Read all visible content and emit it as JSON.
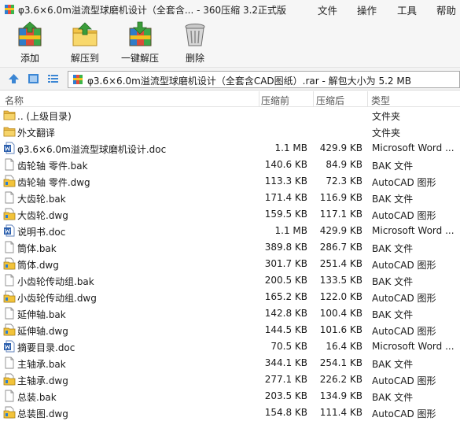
{
  "window": {
    "title": "φ3.6×6.0m溢流型球磨机设计（全套含... - 360压缩 3.2正式版",
    "app_icon": "archive-app-icon"
  },
  "menu": {
    "items": [
      "文件",
      "操作",
      "工具",
      "帮助"
    ]
  },
  "toolbar": {
    "add_label": "添加",
    "extract_label": "解压到",
    "oneclick_label": "一键解压",
    "delete_label": "删除"
  },
  "address": {
    "path_text": "φ3.6×6.0m溢流型球磨机设计（全套含CAD图纸）.rar - 解包大小为 5.2 MB"
  },
  "columns": {
    "name": "名称",
    "size": "压缩前",
    "packed": "压缩后",
    "type": "类型"
  },
  "files": [
    {
      "name": ".. (上级目录)",
      "size": "",
      "packed": "",
      "type": "文件夹",
      "icon": "folder-up-icon"
    },
    {
      "name": "外文翻译",
      "size": "",
      "packed": "",
      "type": "文件夹",
      "icon": "folder-icon"
    },
    {
      "name": "φ3.6×6.0m溢流型球磨机设计.doc",
      "size": "1.1 MB",
      "packed": "429.9 KB",
      "type": "Microsoft Word ...",
      "icon": "word-doc-icon"
    },
    {
      "name": "齿轮轴 零件.bak",
      "size": "140.6 KB",
      "packed": "84.9 KB",
      "type": "BAK 文件",
      "icon": "blank-file-icon"
    },
    {
      "name": "齿轮轴 零件.dwg",
      "size": "113.3 KB",
      "packed": "72.3 KB",
      "type": "AutoCAD 图形",
      "icon": "dwg-file-icon"
    },
    {
      "name": "大齿轮.bak",
      "size": "171.4 KB",
      "packed": "116.9 KB",
      "type": "BAK 文件",
      "icon": "blank-file-icon"
    },
    {
      "name": "大齿轮.dwg",
      "size": "159.5 KB",
      "packed": "117.1 KB",
      "type": "AutoCAD 图形",
      "icon": "dwg-file-icon"
    },
    {
      "name": "说明书.doc",
      "size": "1.1 MB",
      "packed": "429.9 KB",
      "type": "Microsoft Word ...",
      "icon": "word-doc-icon"
    },
    {
      "name": "筒体.bak",
      "size": "389.8 KB",
      "packed": "286.7 KB",
      "type": "BAK 文件",
      "icon": "blank-file-icon"
    },
    {
      "name": "筒体.dwg",
      "size": "301.7 KB",
      "packed": "251.4 KB",
      "type": "AutoCAD 图形",
      "icon": "dwg-file-icon"
    },
    {
      "name": "小齿轮传动组.bak",
      "size": "200.5 KB",
      "packed": "133.5 KB",
      "type": "BAK 文件",
      "icon": "blank-file-icon"
    },
    {
      "name": "小齿轮传动组.dwg",
      "size": "165.2 KB",
      "packed": "122.0 KB",
      "type": "AutoCAD 图形",
      "icon": "dwg-file-icon"
    },
    {
      "name": "延伸轴.bak",
      "size": "142.8 KB",
      "packed": "100.4 KB",
      "type": "BAK 文件",
      "icon": "blank-file-icon"
    },
    {
      "name": "延伸轴.dwg",
      "size": "144.5 KB",
      "packed": "101.6 KB",
      "type": "AutoCAD 图形",
      "icon": "dwg-file-icon"
    },
    {
      "name": "摘要目录.doc",
      "size": "70.5 KB",
      "packed": "16.4 KB",
      "type": "Microsoft Word ...",
      "icon": "word-doc-icon"
    },
    {
      "name": "主轴承.bak",
      "size": "344.1 KB",
      "packed": "254.1 KB",
      "type": "BAK 文件",
      "icon": "blank-file-icon"
    },
    {
      "name": "主轴承.dwg",
      "size": "277.1 KB",
      "packed": "226.2 KB",
      "type": "AutoCAD 图形",
      "icon": "dwg-file-icon"
    },
    {
      "name": "总装.bak",
      "size": "203.5 KB",
      "packed": "134.9 KB",
      "type": "BAK 文件",
      "icon": "blank-file-icon"
    },
    {
      "name": "总装图.dwg",
      "size": "154.8 KB",
      "packed": "111.4 KB",
      "type": "AutoCAD 图形",
      "icon": "dwg-file-icon"
    }
  ]
}
